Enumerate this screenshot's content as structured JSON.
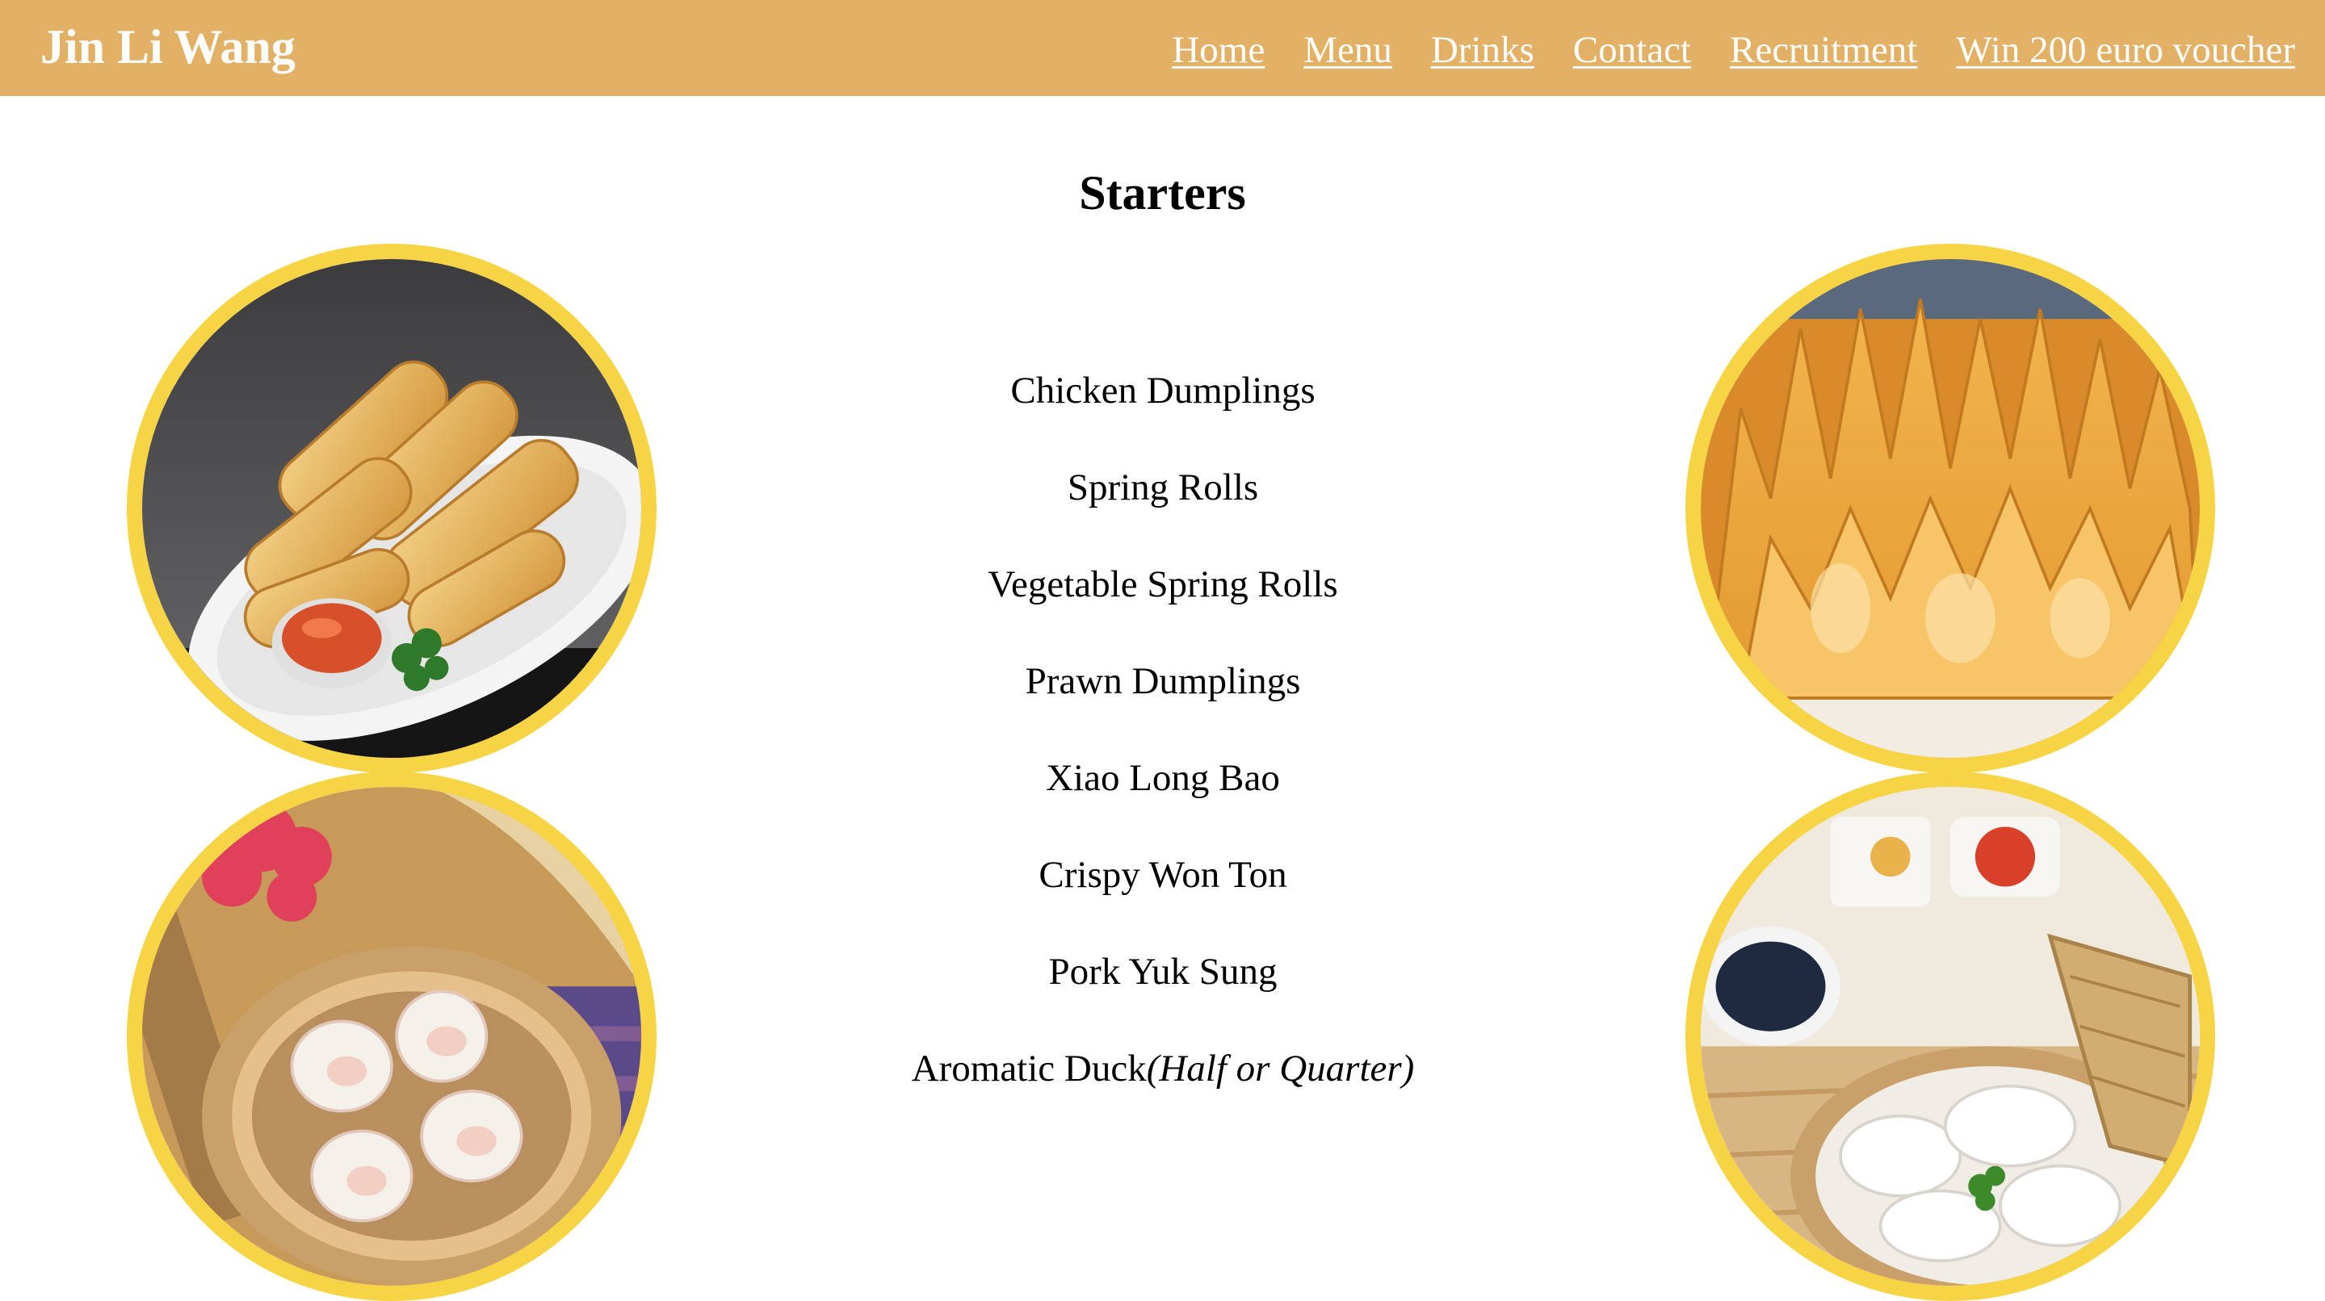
{
  "header": {
    "brand": "Jin Li Wang",
    "nav": {
      "home": "Home",
      "menu": "Menu",
      "drinks": "Drinks",
      "contact": "Contact",
      "recruitment": "Recruitment",
      "voucher": "Win 200 euro voucher"
    }
  },
  "main": {
    "title": "Starters",
    "items": [
      {
        "name": "Chicken Dumplings"
      },
      {
        "name": "Spring Rolls"
      },
      {
        "name": "Vegetable Spring Rolls"
      },
      {
        "name": "Prawn Dumplings"
      },
      {
        "name": "Xiao Long Bao"
      },
      {
        "name": "Crispy Won Ton"
      },
      {
        "name": "Pork Yuk Sung"
      },
      {
        "name": "Aromatic Duck",
        "note": "(Half or Quarter)"
      }
    ]
  },
  "images": [
    {
      "name": "spring-rolls-photo"
    },
    {
      "name": "crispy-won-ton-photo"
    },
    {
      "name": "prawn-dumplings-photo"
    },
    {
      "name": "steamed-dumplings-photo"
    }
  ],
  "colors": {
    "navbar": "#e3b166",
    "photo_border": "#f6d444",
    "nav_text": "#ffffff",
    "body_text": "#000000"
  }
}
